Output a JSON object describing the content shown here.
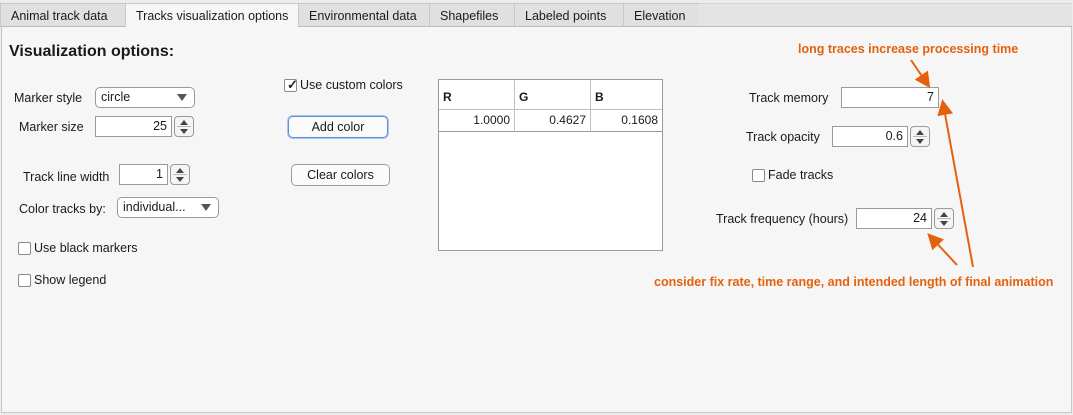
{
  "tabs": [
    {
      "label": "Animal track data",
      "active": false
    },
    {
      "label": "Tracks visualization options",
      "active": true
    },
    {
      "label": "Environmental data",
      "active": false
    },
    {
      "label": "Shapefiles",
      "active": false
    },
    {
      "label": "Labeled points",
      "active": false
    },
    {
      "label": "Elevation",
      "active": false
    }
  ],
  "heading": "Visualization options:",
  "marker_style": {
    "label": "Marker style",
    "value": "circle"
  },
  "marker_size": {
    "label": "Marker size",
    "value": "25"
  },
  "track_line_width": {
    "label": "Track line width",
    "value": "1"
  },
  "color_tracks_by": {
    "label": "Color tracks by:",
    "value": "individual..."
  },
  "use_black_markers": {
    "label": "Use black markers",
    "checked": false
  },
  "show_legend": {
    "label": "Show legend",
    "checked": false
  },
  "use_custom_colors": {
    "label": "Use custom colors",
    "checked": true
  },
  "add_color_button": "Add color",
  "clear_colors_button": "Clear colors",
  "color_table": {
    "headers": [
      "R",
      "G",
      "B"
    ],
    "rows": [
      [
        "1.0000",
        "0.4627",
        "0.1608"
      ]
    ]
  },
  "track_memory": {
    "label": "Track memory",
    "value": "7"
  },
  "track_opacity": {
    "label": "Track opacity",
    "value": "0.6"
  },
  "fade_tracks": {
    "label": "Fade tracks",
    "checked": false
  },
  "track_frequency": {
    "label": "Track frequency (hours)",
    "value": "24"
  },
  "annotations": {
    "top": "long traces increase processing time",
    "bottom": "consider fix rate, time range, and intended length of final animation",
    "color": "#e4620e"
  }
}
